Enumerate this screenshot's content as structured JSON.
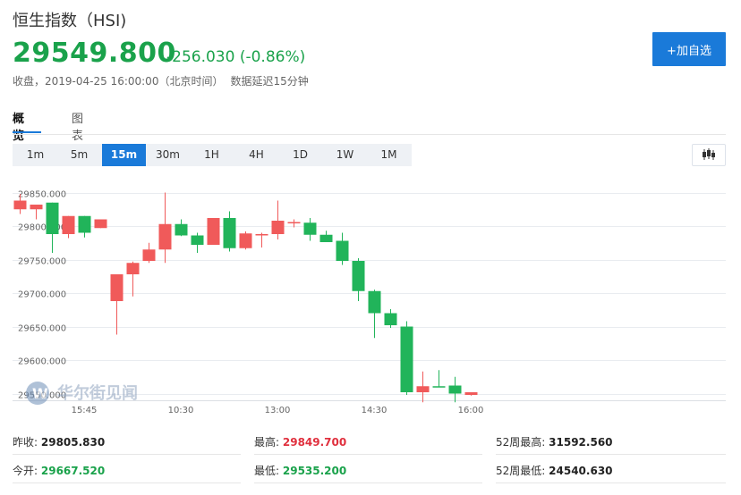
{
  "header": {
    "title": "恒生指数（HSI)",
    "price": "29549.800",
    "change": "-256.030 (-0.86%)",
    "status": "收盘，2019-04-25 16:00:00（北京时间）",
    "delay": "数据延迟15分钟",
    "add_label": "+加自选"
  },
  "tabs": [
    "概览",
    "图表"
  ],
  "periods": [
    "1m",
    "5m",
    "15m",
    "30m",
    "1H",
    "4H",
    "1D",
    "1W",
    "1M"
  ],
  "active_period": "15m",
  "watermark": "华尔街见闻",
  "colors": {
    "up": "#1aa24b",
    "down": "#e0303e",
    "candle_rise": "#f05a5a",
    "candle_fall": "#21b45a",
    "accent": "#1a7ad9"
  },
  "stats": {
    "prev_close_label": "昨收:",
    "prev_close": "29805.830",
    "high_label": "最高:",
    "high": "29849.700",
    "wk52_high_label": "52周最高:",
    "wk52_high": "31592.560",
    "open_label": "今开:",
    "open": "29667.520",
    "low_label": "最低:",
    "low": "29535.200",
    "wk52_low_label": "52周最低:",
    "wk52_low": "24540.630"
  },
  "chart_data": {
    "type": "candlestick",
    "ylim": [
      29540,
      29860
    ],
    "y_ticks": [
      29850,
      29800,
      29750,
      29700,
      29650,
      29600,
      29550
    ],
    "y_tick_labels": [
      "29850.000",
      "29800.000",
      "29750.000",
      "29700.000",
      "29650.000",
      "29600.000",
      "29550.000"
    ],
    "x_ticks": [
      {
        "label": "15:45",
        "index": 4
      },
      {
        "label": "10:30",
        "index": 10
      },
      {
        "label": "13:00",
        "index": 16
      },
      {
        "label": "14:30",
        "index": 22
      },
      {
        "label": "16:00",
        "index": 28
      }
    ],
    "candles": [
      {
        "o": 29825,
        "h": 29848,
        "l": 29818,
        "c": 29838
      },
      {
        "o": 29825,
        "h": 29830,
        "l": 29810,
        "c": 29832
      },
      {
        "o": 29835,
        "h": 29835,
        "l": 29760,
        "c": 29788
      },
      {
        "o": 29788,
        "h": 29815,
        "l": 29782,
        "c": 29815
      },
      {
        "o": 29815,
        "h": 29815,
        "l": 29783,
        "c": 29790
      },
      {
        "o": 29797,
        "h": 29810,
        "l": 29797,
        "c": 29810
      },
      {
        "o": 29688,
        "h": 29720,
        "l": 29638,
        "c": 29728
      },
      {
        "o": 29728,
        "h": 29747,
        "l": 29695,
        "c": 29745
      },
      {
        "o": 29748,
        "h": 29775,
        "l": 29745,
        "c": 29765
      },
      {
        "o": 29765,
        "h": 29850,
        "l": 29745,
        "c": 29803
      },
      {
        "o": 29803,
        "h": 29810,
        "l": 29785,
        "c": 29786
      },
      {
        "o": 29786,
        "h": 29790,
        "l": 29760,
        "c": 29772
      },
      {
        "o": 29772,
        "h": 29812,
        "l": 29772,
        "c": 29812
      },
      {
        "o": 29812,
        "h": 29822,
        "l": 29762,
        "c": 29767
      },
      {
        "o": 29767,
        "h": 29792,
        "l": 29765,
        "c": 29789
      },
      {
        "o": 29786,
        "h": 29790,
        "l": 29768,
        "c": 29788
      },
      {
        "o": 29788,
        "h": 29838,
        "l": 29780,
        "c": 29808
      },
      {
        "o": 29804,
        "h": 29810,
        "l": 29798,
        "c": 29806
      },
      {
        "o": 29805,
        "h": 29812,
        "l": 29778,
        "c": 29787
      },
      {
        "o": 29787,
        "h": 29793,
        "l": 29777,
        "c": 29776
      },
      {
        "o": 29778,
        "h": 29790,
        "l": 29742,
        "c": 29748
      },
      {
        "o": 29748,
        "h": 29752,
        "l": 29688,
        "c": 29703
      },
      {
        "o": 29703,
        "h": 29705,
        "l": 29633,
        "c": 29670
      },
      {
        "o": 29670,
        "h": 29676,
        "l": 29648,
        "c": 29652
      },
      {
        "o": 29650,
        "h": 29658,
        "l": 29548,
        "c": 29552
      },
      {
        "o": 29552,
        "h": 29583,
        "l": 29537,
        "c": 29561
      },
      {
        "o": 29561,
        "h": 29585,
        "l": 29560,
        "c": 29559
      },
      {
        "o": 29562,
        "h": 29575,
        "l": 29537,
        "c": 29550
      },
      {
        "o": 29548,
        "h": 29552,
        "l": 29547,
        "c": 29552
      }
    ]
  }
}
